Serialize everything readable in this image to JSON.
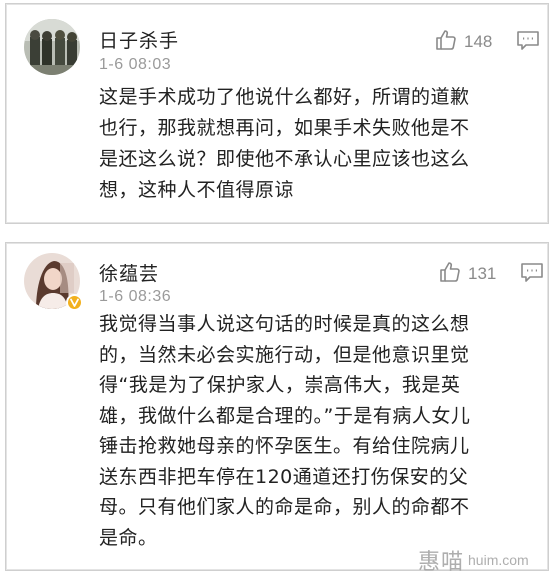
{
  "comments": [
    {
      "username": "日子杀手",
      "timestamp": "1-6 08:03",
      "likes": "148",
      "avatar": "group-photo",
      "verified": false,
      "text_lines": [
        "这是手术成功了他说什么都好，所谓的道歉",
        "也行，那我就想再问，如果手术失败他是不",
        "是还这么说？即使他不承认心里应该也这么",
        "想，这种人不值得原谅"
      ]
    },
    {
      "username": "徐蕴芸",
      "timestamp": "1-6 08:36",
      "likes": "131",
      "avatar": "portrait-photo",
      "verified": true,
      "text_lines": [
        "我觉得当事人说这句话的时候是真的这么想",
        "的，当然未必会实施行动，但是他意识里觉",
        "得“我是为了保护家人，崇高伟大，我是英",
        "雄，我做什么都是合理的。”于是有病人女儿",
        "锤击抢救她母亲的怀孕医生。有给住院病儿",
        "送东西非把车停在120通道还打伤保安的父",
        "母。只有他们家人的命是命，别人的命都不",
        "是命。"
      ]
    }
  ],
  "icons": {
    "like": "thumbs-up-icon",
    "comment": "comment-icon",
    "verified": "verified-badge-icon"
  },
  "colors": {
    "text": "#222222",
    "meta": "#9a9a9a",
    "badge": "#f2b01e"
  },
  "watermark": {
    "cn": "惠喵",
    "en": "huim.com"
  }
}
